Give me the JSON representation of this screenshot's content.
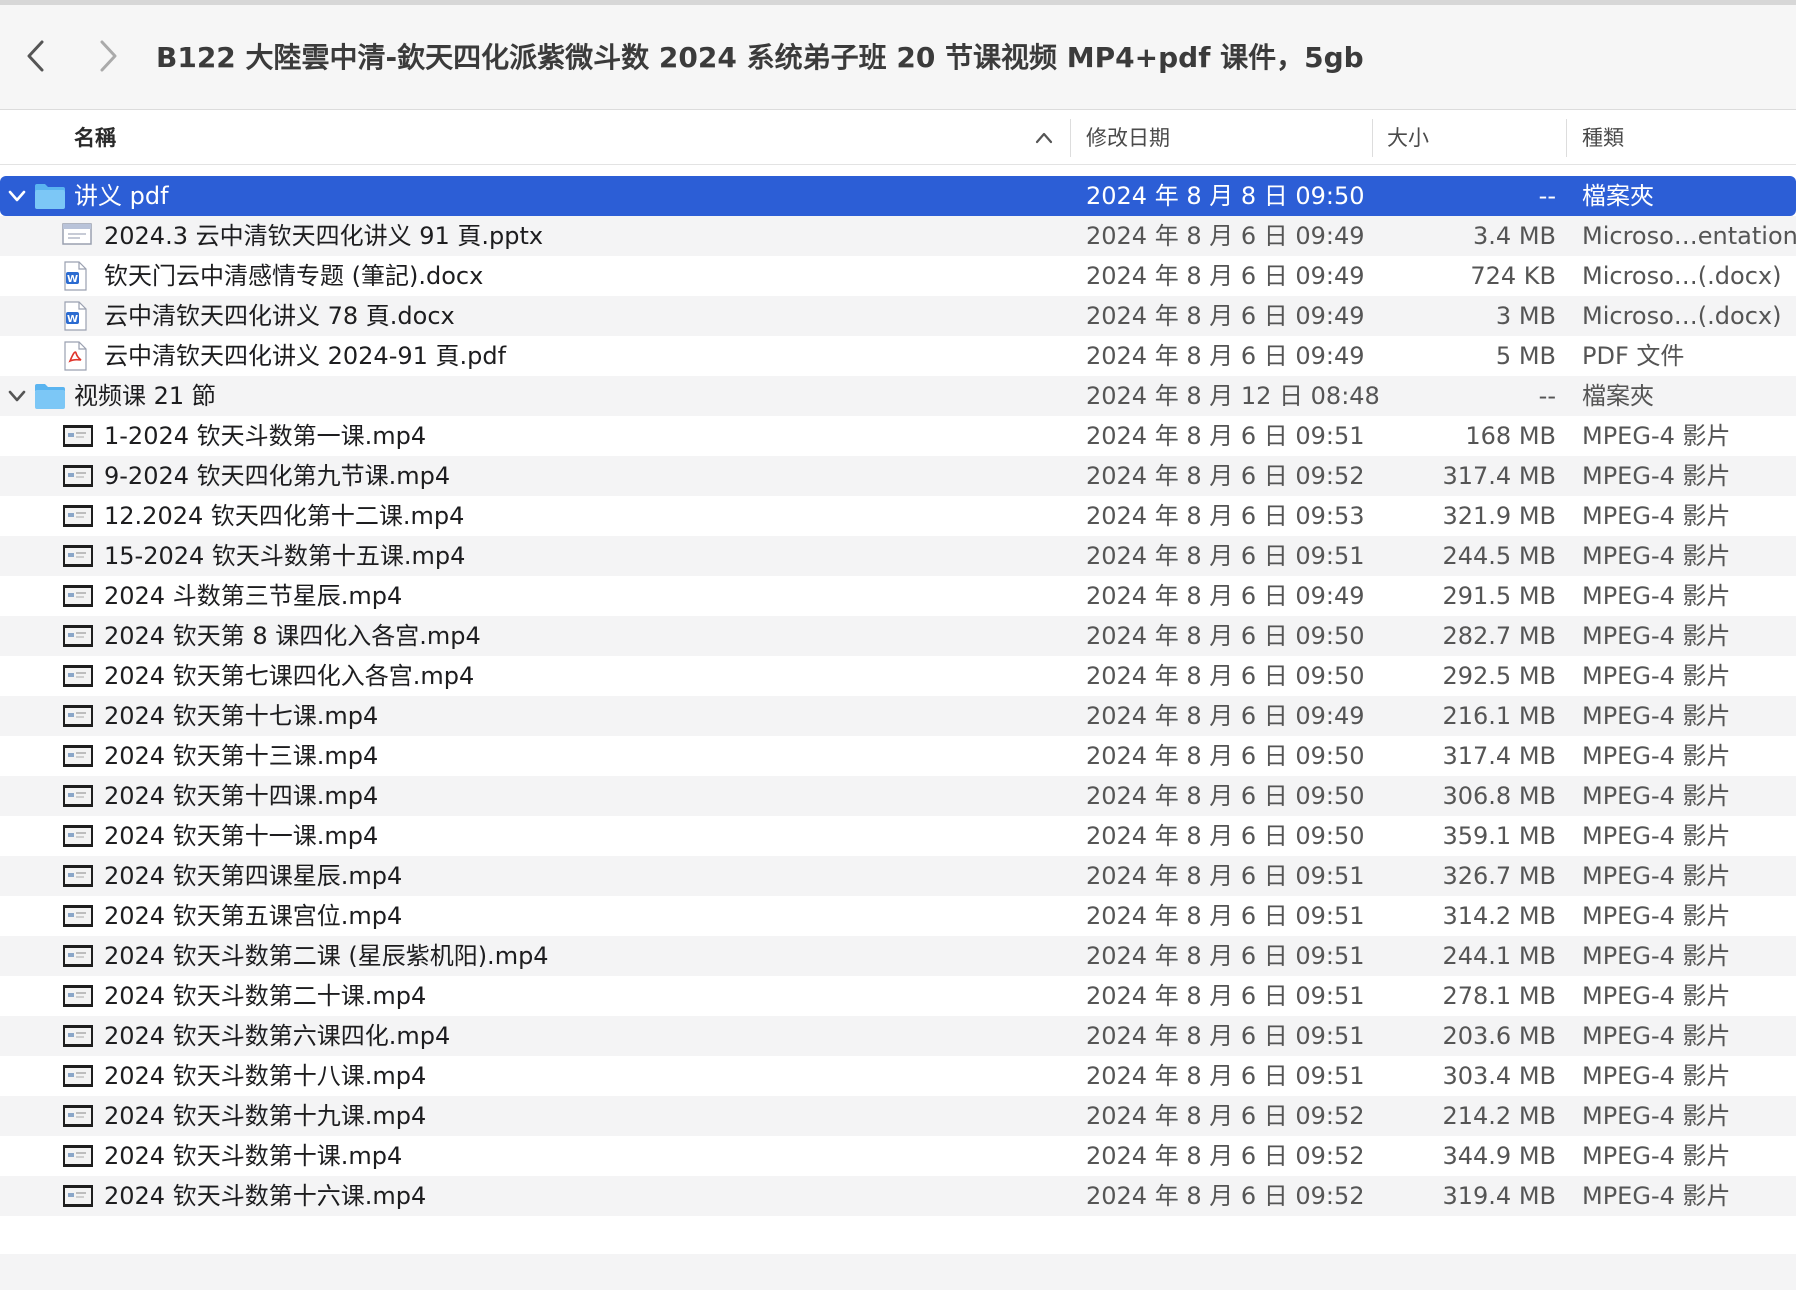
{
  "window": {
    "title": "B122 大陸雲中清-欽天四化派紫微斗数 2024 系统弟子班 20 节课视频 MP4+pdf 课件，5gb"
  },
  "columns": {
    "name": "名稱",
    "date": "修改日期",
    "size": "大小",
    "kind": "種類"
  },
  "colors": {
    "selection": "#2c5ed6",
    "folder": "#5ab4f0",
    "stripe": "#f4f4f5"
  },
  "rows": [
    {
      "level": 0,
      "disclosure": "open",
      "icon": "folder-icon",
      "name": "讲义 pdf",
      "date": "2024 年 8 月 8 日 09:50",
      "size": "--",
      "kind": "檔案夾",
      "selected": true
    },
    {
      "level": 1,
      "icon": "pptx-icon",
      "name": "2024.3 云中清钦天四化讲义 91 頁.pptx",
      "date": "2024 年 8 月 6 日 09:49",
      "size": "3.4 MB",
      "kind": "Microso…entation"
    },
    {
      "level": 1,
      "icon": "docx-icon",
      "name": "钦天门云中清感情专题 (筆記).docx",
      "date": "2024 年 8 月 6 日 09:49",
      "size": "724 KB",
      "kind": "Microso…(.docx)"
    },
    {
      "level": 1,
      "icon": "docx-icon",
      "name": "云中清钦天四化讲义 78 頁.docx",
      "date": "2024 年 8 月 6 日 09:49",
      "size": "3 MB",
      "kind": "Microso…(.docx)"
    },
    {
      "level": 1,
      "icon": "pdf-icon",
      "name": "云中清钦天四化讲义 2024-91 頁.pdf",
      "date": "2024 年 8 月 6 日 09:49",
      "size": "5 MB",
      "kind": "PDF 文件"
    },
    {
      "level": 0,
      "disclosure": "open",
      "icon": "folder-icon",
      "name": "视频课 21 節",
      "date": "2024 年 8 月 12 日 08:48",
      "size": "--",
      "kind": "檔案夾"
    },
    {
      "level": 1,
      "icon": "video-thumbnail-icon",
      "name": "1-2024 钦天斗数第一课.mp4",
      "date": "2024 年 8 月 6 日 09:51",
      "size": "168 MB",
      "kind": "MPEG-4 影片"
    },
    {
      "level": 1,
      "icon": "video-thumbnail-icon",
      "name": "9-2024 钦天四化第九节课.mp4",
      "date": "2024 年 8 月 6 日 09:52",
      "size": "317.4 MB",
      "kind": "MPEG-4 影片"
    },
    {
      "level": 1,
      "icon": "video-thumbnail-icon",
      "name": "12.2024 钦天四化第十二课.mp4",
      "date": "2024 年 8 月 6 日 09:53",
      "size": "321.9 MB",
      "kind": "MPEG-4 影片"
    },
    {
      "level": 1,
      "icon": "video-thumbnail-icon",
      "name": "15-2024 钦天斗数第十五课.mp4",
      "date": "2024 年 8 月 6 日 09:51",
      "size": "244.5 MB",
      "kind": "MPEG-4 影片"
    },
    {
      "level": 1,
      "icon": "video-thumbnail-icon",
      "name": "2024 斗数第三节星辰.mp4",
      "date": "2024 年 8 月 6 日 09:49",
      "size": "291.5 MB",
      "kind": "MPEG-4 影片"
    },
    {
      "level": 1,
      "icon": "video-thumbnail-icon",
      "name": "2024 钦天第 8 课四化入各宫.mp4",
      "date": "2024 年 8 月 6 日 09:50",
      "size": "282.7 MB",
      "kind": "MPEG-4 影片"
    },
    {
      "level": 1,
      "icon": "video-thumbnail-icon",
      "name": "2024 钦天第七课四化入各宫.mp4",
      "date": "2024 年 8 月 6 日 09:50",
      "size": "292.5 MB",
      "kind": "MPEG-4 影片"
    },
    {
      "level": 1,
      "icon": "video-thumbnail-icon",
      "name": "2024 钦天第十七课.mp4",
      "date": "2024 年 8 月 6 日 09:49",
      "size": "216.1 MB",
      "kind": "MPEG-4 影片"
    },
    {
      "level": 1,
      "icon": "video-thumbnail-icon",
      "name": "2024 钦天第十三课.mp4",
      "date": "2024 年 8 月 6 日 09:50",
      "size": "317.4 MB",
      "kind": "MPEG-4 影片"
    },
    {
      "level": 1,
      "icon": "video-thumbnail-icon",
      "name": "2024 钦天第十四课.mp4",
      "date": "2024 年 8 月 6 日 09:50",
      "size": "306.8 MB",
      "kind": "MPEG-4 影片"
    },
    {
      "level": 1,
      "icon": "video-thumbnail-icon",
      "name": "2024 钦天第十一课.mp4",
      "date": "2024 年 8 月 6 日 09:50",
      "size": "359.1 MB",
      "kind": "MPEG-4 影片"
    },
    {
      "level": 1,
      "icon": "video-thumbnail-icon",
      "name": "2024 钦天第四课星辰.mp4",
      "date": "2024 年 8 月 6 日 09:51",
      "size": "326.7 MB",
      "kind": "MPEG-4 影片"
    },
    {
      "level": 1,
      "icon": "video-thumbnail-icon",
      "name": "2024 钦天第五课宫位.mp4",
      "date": "2024 年 8 月 6 日 09:51",
      "size": "314.2 MB",
      "kind": "MPEG-4 影片"
    },
    {
      "level": 1,
      "icon": "video-thumbnail-icon",
      "name": "2024 钦天斗数第二课 (星辰紫机阳).mp4",
      "date": "2024 年 8 月 6 日 09:51",
      "size": "244.1 MB",
      "kind": "MPEG-4 影片"
    },
    {
      "level": 1,
      "icon": "video-thumbnail-icon",
      "name": "2024 钦天斗数第二十课.mp4",
      "date": "2024 年 8 月 6 日 09:51",
      "size": "278.1 MB",
      "kind": "MPEG-4 影片"
    },
    {
      "level": 1,
      "icon": "video-thumbnail-icon",
      "name": "2024 钦天斗数第六课四化.mp4",
      "date": "2024 年 8 月 6 日 09:51",
      "size": "203.6 MB",
      "kind": "MPEG-4 影片"
    },
    {
      "level": 1,
      "icon": "video-thumbnail-icon",
      "name": "2024 钦天斗数第十八课.mp4",
      "date": "2024 年 8 月 6 日 09:51",
      "size": "303.4 MB",
      "kind": "MPEG-4 影片"
    },
    {
      "level": 1,
      "icon": "video-thumbnail-icon",
      "name": "2024 钦天斗数第十九课.mp4",
      "date": "2024 年 8 月 6 日 09:52",
      "size": "214.2 MB",
      "kind": "MPEG-4 影片"
    },
    {
      "level": 1,
      "icon": "video-thumbnail-icon",
      "name": "2024 钦天斗数第十课.mp4",
      "date": "2024 年 8 月 6 日 09:52",
      "size": "344.9 MB",
      "kind": "MPEG-4 影片"
    },
    {
      "level": 1,
      "icon": "video-thumbnail-icon",
      "name": "2024 钦天斗数第十六课.mp4",
      "date": "2024 年 8 月 6 日 09:52",
      "size": "319.4 MB",
      "kind": "MPEG-4 影片"
    }
  ]
}
